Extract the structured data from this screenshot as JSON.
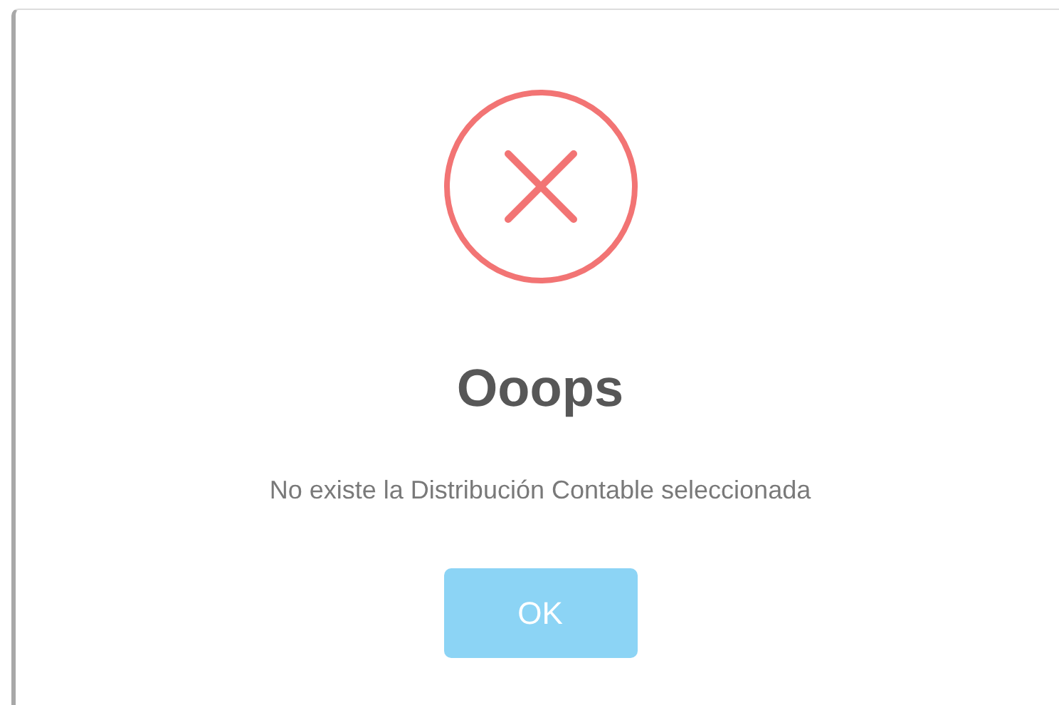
{
  "dialog": {
    "icon": {
      "kind": "error"
    },
    "title": "Ooops",
    "message": "No existe la Distribución Contable seleccionada",
    "buttons": [
      {
        "label": "OK"
      }
    ]
  }
}
